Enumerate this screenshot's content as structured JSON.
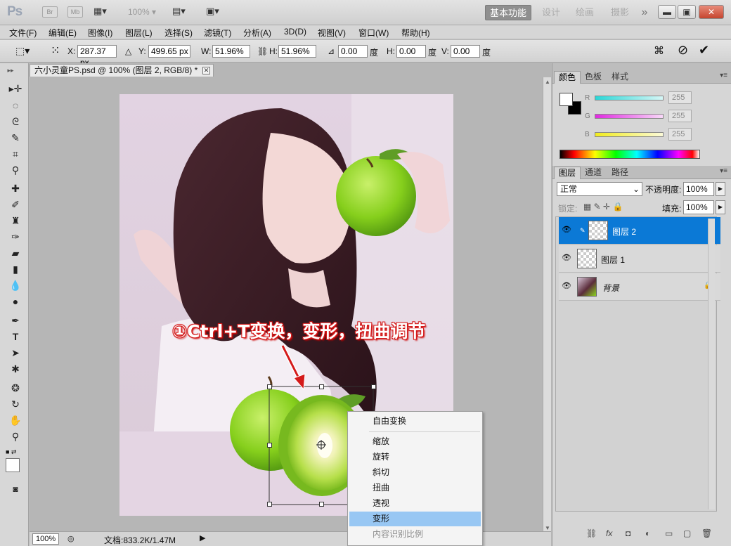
{
  "titlebar": {
    "logo": "Ps",
    "bridge": "Br",
    "minibridge": "Mb",
    "zoom": "100%",
    "workspaces": [
      "基本功能",
      "设计",
      "绘画",
      "摄影"
    ],
    "more": "»",
    "win_min": "▬",
    "win_restore": "▣",
    "win_close": "✕"
  },
  "menu": [
    "文件(F)",
    "编辑(E)",
    "图像(I)",
    "图层(L)",
    "选择(S)",
    "滤镜(T)",
    "分析(A)",
    "3D(D)",
    "视图(V)",
    "窗口(W)",
    "帮助(H)"
  ],
  "options": {
    "x_label": "X:",
    "x_value": "287.37 px",
    "y_label": "Y:",
    "y_value": "499.65 px",
    "w_label": "W:",
    "w_value": "51.96%",
    "h_label": "H:",
    "h_value": "51.96%",
    "angle_value": "0.00",
    "angle_unit": "度",
    "hskew_label": "H:",
    "hskew_value": "0.00",
    "hskew_unit": "度",
    "vskew_label": "V:",
    "vskew_value": "0.00",
    "vskew_unit": "度"
  },
  "document": {
    "tab_title": "六小灵童PS.psd @ 100% (图层 2, RGB/8) *",
    "zoom": "100%",
    "status": "文档:833.2K/1.47M"
  },
  "annotation": "①Ctrl+T变换，变形，扭曲调节",
  "context_menu": {
    "items": [
      {
        "label": "自由变换",
        "state": "normal"
      },
      {
        "label": "缩放",
        "state": "normal"
      },
      {
        "label": "旋转",
        "state": "normal"
      },
      {
        "label": "斜切",
        "state": "normal"
      },
      {
        "label": "扭曲",
        "state": "normal"
      },
      {
        "label": "透视",
        "state": "normal"
      },
      {
        "label": "变形",
        "state": "highlighted"
      },
      {
        "label": "内容识别比例",
        "state": "disabled"
      }
    ]
  },
  "color_panel": {
    "tabs": [
      "颜色",
      "色板",
      "样式"
    ],
    "channels": [
      {
        "label": "R",
        "value": "255",
        "color": "#23e3e3"
      },
      {
        "label": "G",
        "value": "255",
        "color": "#e324e3"
      },
      {
        "label": "B",
        "value": "255",
        "color": "#f0f020"
      }
    ]
  },
  "layers_panel": {
    "tabs": [
      "图层",
      "通道",
      "路径"
    ],
    "blend_mode": "正常",
    "opacity_label": "不透明度:",
    "opacity_value": "100%",
    "lock_label": "锁定:",
    "fill_label": "填充:",
    "fill_value": "100%",
    "layers": [
      {
        "name": "图层 2",
        "selected": true
      },
      {
        "name": "图层 1",
        "selected": false
      },
      {
        "name": "背景",
        "selected": false,
        "locked": true
      }
    ]
  },
  "colors": {
    "accent": "#0b79d6",
    "menu_highlight": "#98c7f3",
    "annotation_red": "#d41a1a",
    "apple_green": "#8bd21e"
  }
}
